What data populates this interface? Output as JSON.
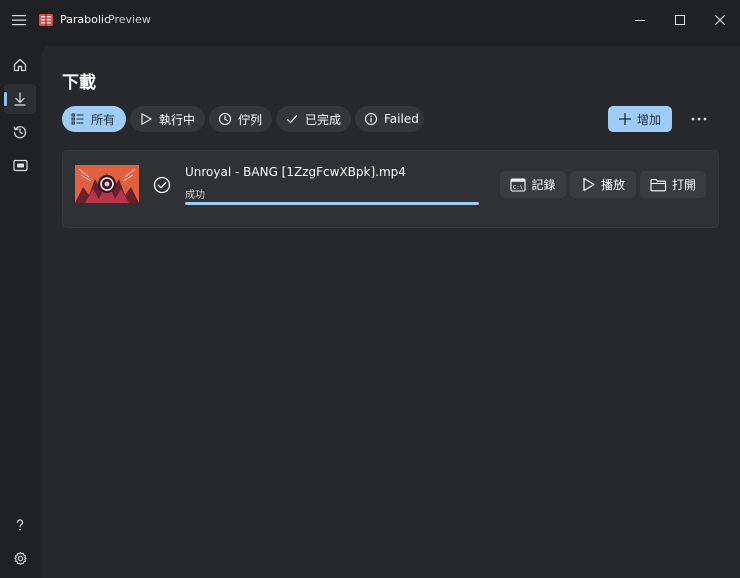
{
  "window": {
    "app_name": "Parabolic",
    "app_subtitle": "Preview"
  },
  "page": {
    "title": "下載"
  },
  "filters": [
    {
      "label": "所有",
      "icon": "list-icon",
      "selected": true
    },
    {
      "label": "執行中",
      "icon": "play-icon",
      "selected": false
    },
    {
      "label": "佇列",
      "icon": "clock-icon",
      "selected": false
    },
    {
      "label": "已完成",
      "icon": "check-icon",
      "selected": false
    },
    {
      "label": "Failed",
      "icon": "info-icon",
      "selected": false
    }
  ],
  "toolbar": {
    "add_label": "增加"
  },
  "downloads": [
    {
      "file_name": "Unroyal - BANG [1ZzgFcwXBpk].mp4",
      "status": "成功",
      "progress": 1.0,
      "actions": {
        "log": "記錄",
        "play": "播放",
        "open": "打開"
      }
    }
  ],
  "colors": {
    "accent": "#9dcdf5",
    "background": "#202124",
    "surface": "#27282b"
  }
}
